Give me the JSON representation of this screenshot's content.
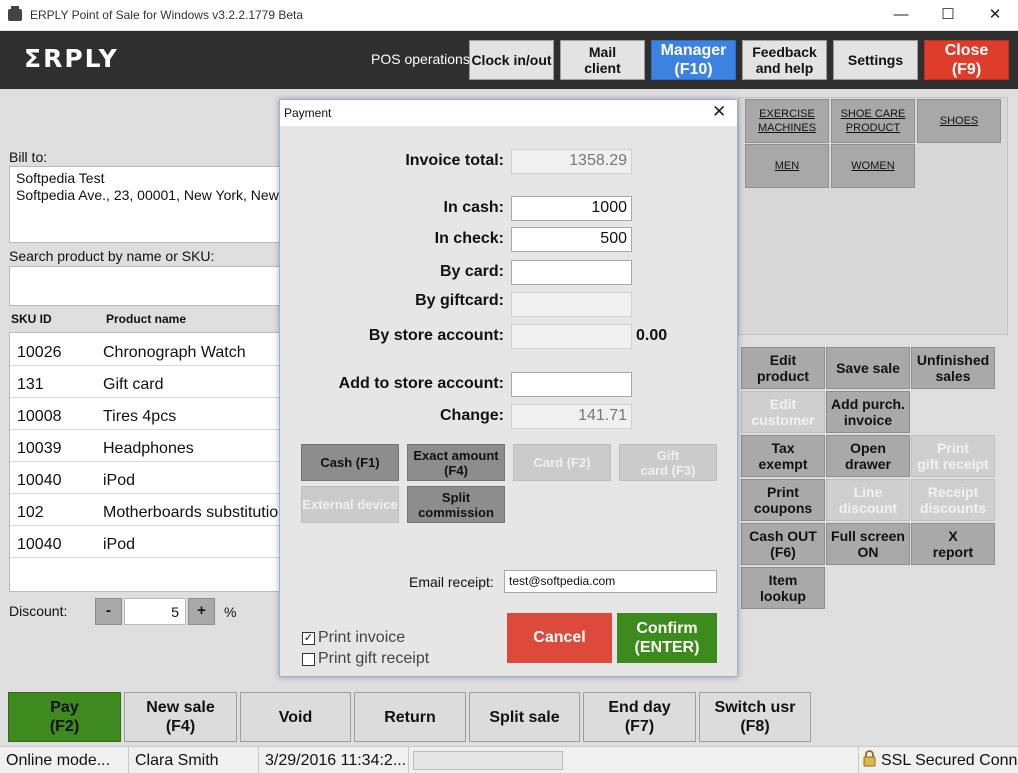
{
  "window": {
    "title": "ERPLY Point of Sale for Windows v3.2.2.1779 Beta",
    "minimize": "—",
    "maximize": "☐",
    "close": "✕"
  },
  "header": {
    "logo": "ΣRPLY",
    "pos_operations": "POS operations",
    "buttons": {
      "clock": "Clock in/out",
      "mail": "Mail\nclient",
      "manager": "Manager\n(F10)",
      "feedback": "Feedback\nand help",
      "settings": "Settings",
      "close": "Close\n(F9)"
    }
  },
  "left": {
    "bill_to_label": "Bill to:",
    "bill_to_name": "Softpedia Test",
    "bill_to_address": "Softpedia Ave., 23, 00001, New York, New",
    "search_label": "Search product by name or SKU:",
    "col_sku": "SKU ID",
    "col_name": "Product name",
    "products": [
      {
        "sku": "10026",
        "name": "Chronograph Watch"
      },
      {
        "sku": "131",
        "name": "Gift card"
      },
      {
        "sku": "10008",
        "name": "Tires 4pcs"
      },
      {
        "sku": "10039",
        "name": "Headphones"
      },
      {
        "sku": "10040",
        "name": "iPod"
      },
      {
        "sku": "102",
        "name": "Motherboards substitution"
      },
      {
        "sku": "10040",
        "name": "iPod"
      }
    ],
    "discount_label": "Discount:",
    "discount_minus": "-",
    "discount_value": "5",
    "discount_plus": "+",
    "discount_unit": "%"
  },
  "categories": {
    "exercise": "EXERCISE\nMACHINES",
    "shoe_care": "SHOE CARE\nPRODUCT",
    "shoes": "SHOES",
    "men": "MEN",
    "women": "WOMEN"
  },
  "actions": {
    "edit_product": "Edit\nproduct",
    "save_sale": "Save sale",
    "unfinished_sales": "Unfinished\nsales",
    "edit_customer": "Edit\ncustomer",
    "add_purch_invoice": "Add purch.\ninvoice",
    "tax_exempt": "Tax\nexempt",
    "open_drawer": "Open\ndrawer",
    "print_gift_receipt": "Print\ngift receipt",
    "print_coupons": "Print\ncoupons",
    "line_discount": "Line\ndiscount",
    "receipt_discounts": "Receipt\ndiscounts",
    "cash_out": "Cash OUT\n(F6)",
    "full_screen": "Full screen\nON",
    "x_report": "X\nreport",
    "item_lookup": "Item\nlookup"
  },
  "payment": {
    "title": "Payment",
    "close": "✕",
    "invoice_total_label": "Invoice total:",
    "invoice_total": "1358.29",
    "in_cash_label": "In cash:",
    "in_cash": "1000",
    "in_check_label": "In check:",
    "in_check": "500",
    "by_card_label": "By card:",
    "by_card": "",
    "by_giftcard_label": "By giftcard:",
    "by_giftcard": "",
    "by_store_account_label": "By store account:",
    "store_account_value": "0.00",
    "add_store_account_label": "Add to store account:",
    "add_store_account": "",
    "change_label": "Change:",
    "change": "141.71",
    "buttons": {
      "cash": "Cash (F1)",
      "exact_amount": "Exact amount\n(F4)",
      "card": "Card (F2)",
      "gift_card": "Gift\ncard (F3)",
      "external_device": "External device",
      "split_commission": "Split\ncommission"
    },
    "email_label": "Email receipt:",
    "email_value": "test@softpedia.com",
    "print_invoice_label": "Print invoice",
    "print_invoice_checked": true,
    "print_gift_receipt_label": "Print gift receipt",
    "print_gift_receipt_checked": false,
    "cancel": "Cancel",
    "confirm": "Confirm\n(ENTER)"
  },
  "bottom": {
    "pay": "Pay\n(F2)",
    "new_sale": "New sale\n(F4)",
    "void": "Void",
    "return": "Return",
    "split_sale": "Split sale",
    "end_day": "End day\n(F7)",
    "switch_user": "Switch usr\n(F8)"
  },
  "status": {
    "mode": "Online mode...",
    "user": "Clara Smith",
    "datetime": "3/29/2016 11:34:2...",
    "ssl": "SSL Secured Conne"
  },
  "colors": {
    "header_bg": "#2f2f2f",
    "manager_blue": "#3c82e0",
    "close_red": "#dd3d2a",
    "pay_green": "#3f8a1e",
    "confirm_green": "#3d8b1d",
    "cancel_red": "#dd4a3b"
  }
}
